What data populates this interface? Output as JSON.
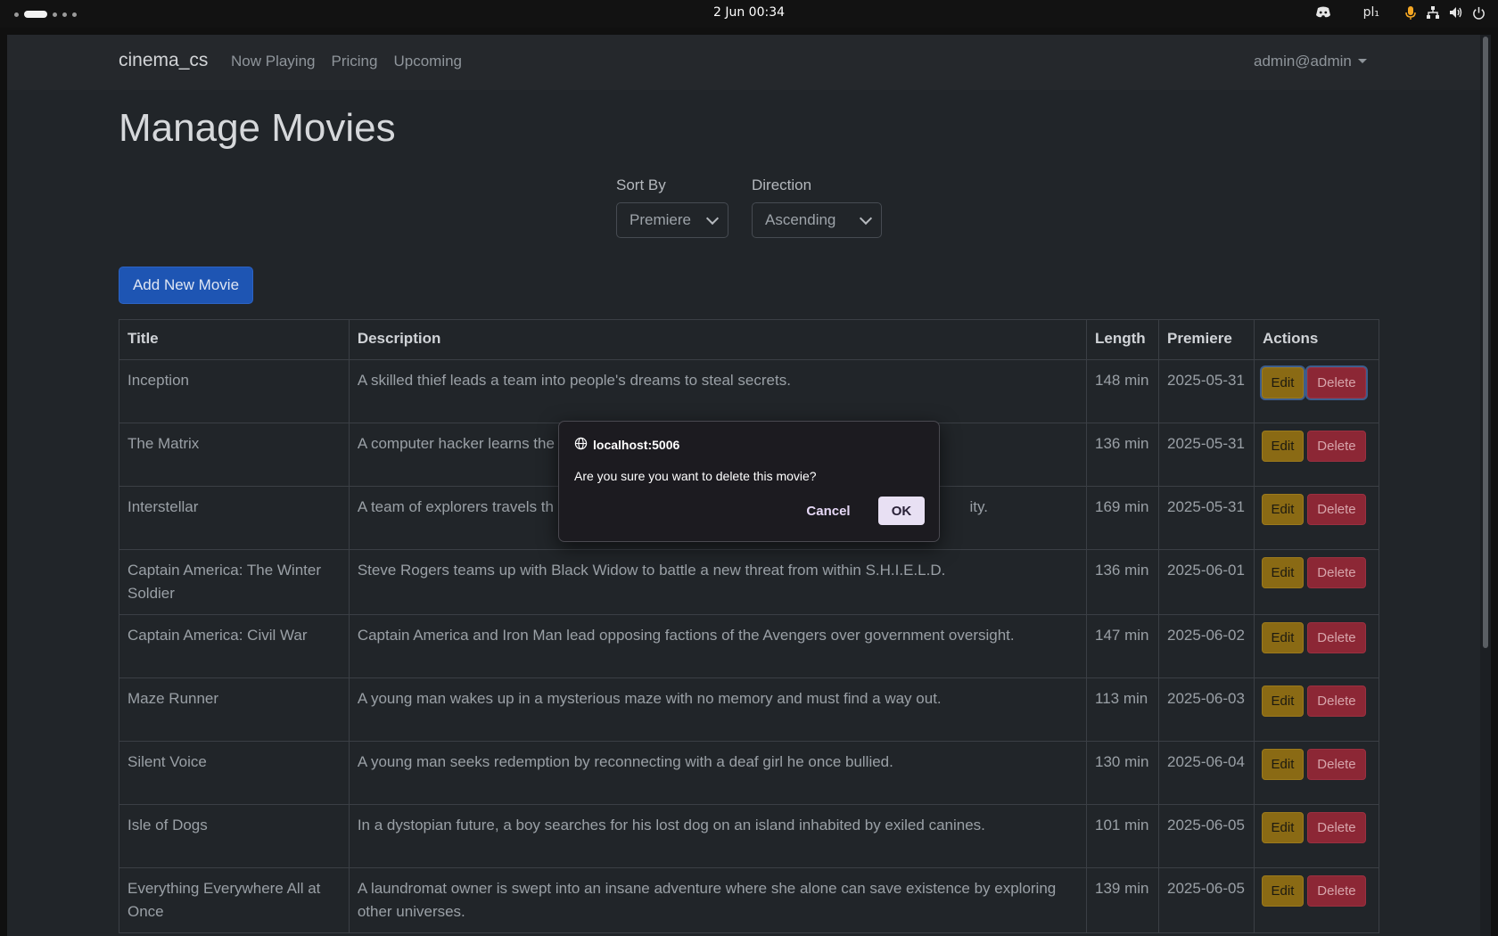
{
  "system_bar": {
    "clock": "2 Jun  00:34",
    "keyboard_layout": "pl₁"
  },
  "navbar": {
    "brand": "cinema_cs",
    "links": [
      "Now Playing",
      "Pricing",
      "Upcoming"
    ],
    "user": "admin@admin"
  },
  "page": {
    "title": "Manage Movies",
    "sort_by_label": "Sort By",
    "sort_by_value": "Premiere",
    "direction_label": "Direction",
    "direction_value": "Ascending",
    "add_button": "Add New Movie"
  },
  "table": {
    "headers": [
      "Title",
      "Description",
      "Length",
      "Premiere",
      "Actions"
    ],
    "edit_label": "Edit",
    "delete_label": "Delete",
    "rows": [
      {
        "title": "Inception",
        "description": "A skilled thief leads a team into people's dreams to steal secrets.",
        "length": "148 min",
        "premiere": "2025-05-31"
      },
      {
        "title": "The Matrix",
        "description": "A computer hacker learns the",
        "length": "136 min",
        "premiere": "2025-05-31"
      },
      {
        "title": "Interstellar",
        "description": "A team of explorers travels th",
        "description_tail": "ity.",
        "length": "169 min",
        "premiere": "2025-05-31"
      },
      {
        "title": "Captain America: The Winter Soldier",
        "description": "Steve Rogers teams up with Black Widow to battle a new threat from within S.H.I.E.L.D.",
        "length": "136 min",
        "premiere": "2025-06-01"
      },
      {
        "title": "Captain America: Civil War",
        "description": "Captain America and Iron Man lead opposing factions of the Avengers over government oversight.",
        "length": "147 min",
        "premiere": "2025-06-02"
      },
      {
        "title": "Maze Runner",
        "description": "A young man wakes up in a mysterious maze with no memory and must find a way out.",
        "length": "113 min",
        "premiere": "2025-06-03"
      },
      {
        "title": "Silent Voice",
        "description": "A young man seeks redemption by reconnecting with a deaf girl he once bullied.",
        "length": "130 min",
        "premiere": "2025-06-04"
      },
      {
        "title": "Isle of Dogs",
        "description": "In a dystopian future, a boy searches for his lost dog on an island inhabited by exiled canines.",
        "length": "101 min",
        "premiere": "2025-06-05"
      },
      {
        "title": "Everything Everywhere All at Once",
        "description": "A laundromat owner is swept into an insane adventure where she alone can save existence by exploring other universes.",
        "length": "139 min",
        "premiere": "2025-06-05"
      }
    ]
  },
  "dialog": {
    "origin": "localhost:5006",
    "message": "Are you sure you want to delete this movie?",
    "cancel": "Cancel",
    "ok": "OK"
  },
  "icons": {
    "origin": "globe-icon",
    "tray": [
      "discord-icon",
      "microphone-icon",
      "network-icon",
      "volume-icon",
      "power-icon"
    ]
  },
  "colors": {
    "add_button": "#1e55b3",
    "edit_button": "#8a6a14",
    "delete_button": "#8c2735",
    "page_background": "#212529"
  }
}
